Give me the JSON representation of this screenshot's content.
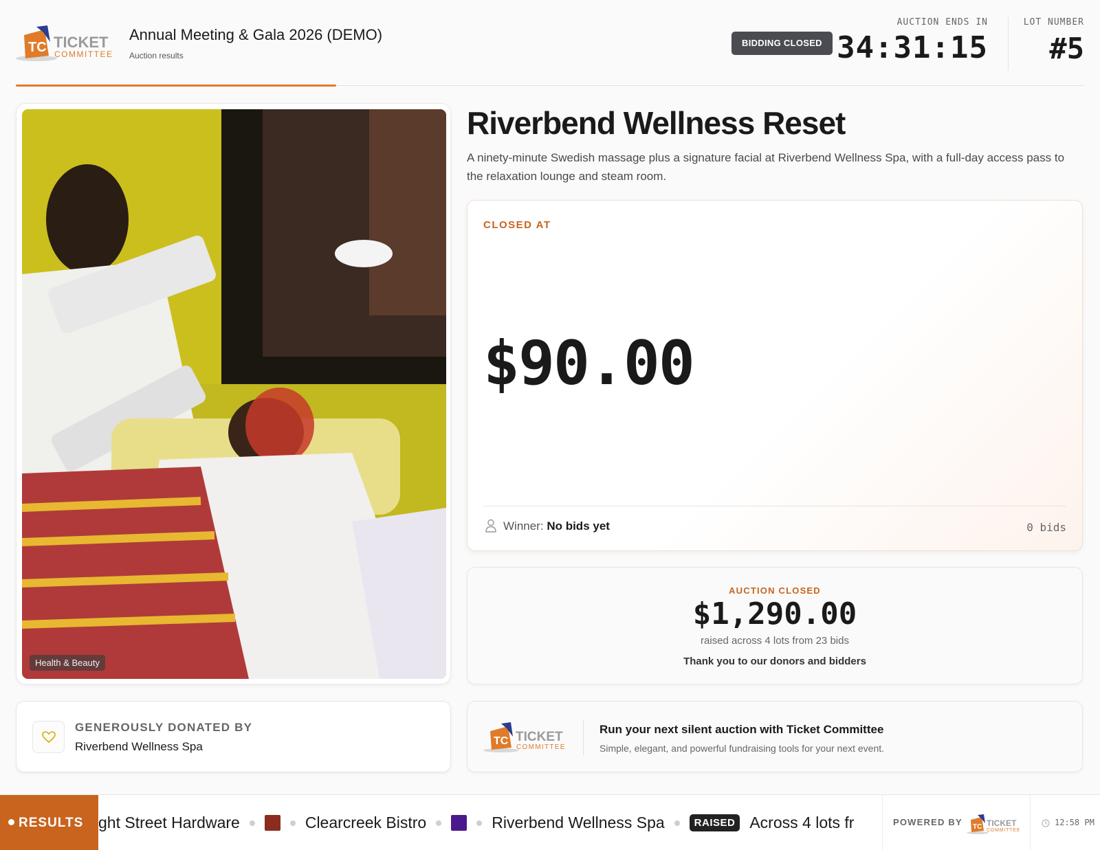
{
  "header": {
    "event_title": "Annual Meeting & Gala 2026 (DEMO)",
    "event_subtitle": "Auction results",
    "status_pill": "BIDDING CLOSED",
    "ends_label": "AUCTION ENDS IN",
    "timer": "34:31:15",
    "lot_label": "LOT NUMBER",
    "lot_number": "#5",
    "progress_fraction": 0.3
  },
  "logo": {
    "word1": "TICKET",
    "word2": "COMMITTEE",
    "monogram": "TC"
  },
  "item": {
    "title": "Riverbend Wellness Reset",
    "description": "A ninety-minute Swedish massage plus a signature facial at Riverbend Wellness Spa, with a full-day access pass to the relaxation lounge and steam room.",
    "category": "Health & Beauty"
  },
  "donor": {
    "label": "GENEROUSLY DONATED BY",
    "name": "Riverbend Wellness Spa"
  },
  "price_card": {
    "label": "CLOSED AT",
    "price": "$90.00",
    "winner_label": "Winner:",
    "winner_value": "No bids yet",
    "bids": "0 bids"
  },
  "summary": {
    "label": "AUCTION CLOSED",
    "amount": "$1,290.00",
    "subtext": "raised across 4 lots from 23 bids",
    "thanks": "Thank you to our donors and bidders"
  },
  "promo": {
    "title": "Run your next silent auction with Ticket Committee",
    "subtitle": "Simple, elegant, and powerful fundraising tools for your next event."
  },
  "ticker": {
    "tag": "RESULTS",
    "item1": "ght Street Hardware",
    "item2": "Clearcreek Bistro",
    "item3": "Riverbend Wellness Spa",
    "raised_tag": "RAISED",
    "raised_text": "Across 4 lots fr",
    "swatch1_color": "#8b2c1f",
    "swatch2_color": "#4a1a8c",
    "powered_label": "POWERED BY",
    "time": "12:58 PM"
  },
  "colors": {
    "accent": "#c8641e",
    "progress": "#e07b2a",
    "logo_orange": "#e07b2a",
    "logo_blue": "#2a3d8f"
  }
}
